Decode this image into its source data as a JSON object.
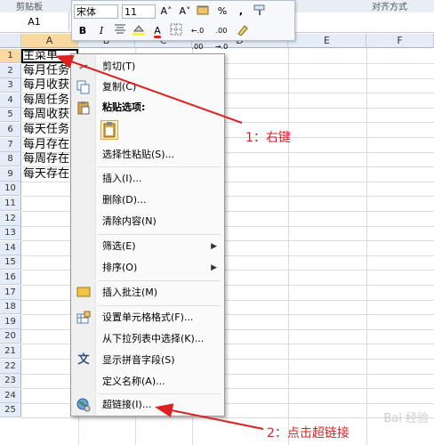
{
  "ribbon": {
    "clipboard_label": "剪贴板",
    "alignment_label": "对齐方式"
  },
  "namebox": {
    "value": "A1"
  },
  "mini_toolbar": {
    "font_name": "宋体",
    "font_size": "11",
    "grow_font": "A˄",
    "shrink_font": "A˅",
    "percent": "%",
    "comma": ",",
    "bold": "B",
    "italic": "I",
    "font_color_letter": "A",
    "increase_decimal": "←.0 .00",
    "decrease_decimal": ".00 →.0"
  },
  "columns": [
    "A",
    "B",
    "C",
    "D",
    "E",
    "F"
  ],
  "rows": [
    "1",
    "2",
    "3",
    "4",
    "5",
    "6",
    "7",
    "8",
    "9",
    "10",
    "11",
    "12",
    "13",
    "14",
    "15",
    "16",
    "17",
    "18",
    "19",
    "20",
    "21",
    "22",
    "23",
    "24",
    "25"
  ],
  "cells_a": [
    "主菜单",
    "每月任务",
    "每月收获",
    "每周任务",
    "每周收获",
    "每天任务",
    "每月存在",
    "每周存在",
    "每天存在"
  ],
  "context_menu": {
    "cut": "剪切(T)",
    "copy": "复制(C)",
    "paste_options": "粘贴选项:",
    "paste_special": "选择性粘贴(S)...",
    "insert": "插入(I)...",
    "delete": "删除(D)...",
    "clear": "清除内容(N)",
    "filter": "筛选(E)",
    "sort": "排序(O)",
    "insert_comment": "插入批注(M)",
    "format_cells": "设置单元格格式(F)...",
    "pick_list": "从下拉列表中选择(K)...",
    "phonetic": "显示拼音字段(S)",
    "define_name": "定义名称(A)...",
    "hyperlink": "超链接(I)..."
  },
  "annotations": {
    "step1": "1：右键",
    "step2": "2：点击超链接"
  },
  "watermark": "Bai 经验",
  "colors": {
    "annotation": "#e02020",
    "header_bg": "#e4ecf7",
    "selected_header": "#f9d99f"
  }
}
